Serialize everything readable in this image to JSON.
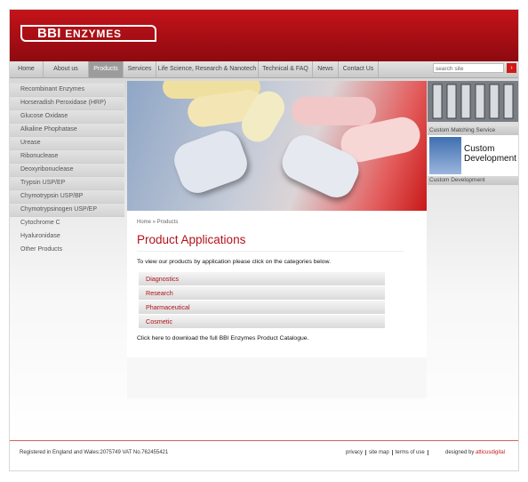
{
  "brand": {
    "logo_main": "BBI",
    "logo_sub": "ENZYMES"
  },
  "nav": {
    "items": [
      {
        "label": "Home"
      },
      {
        "label": "About us"
      },
      {
        "label": "Products"
      },
      {
        "label": "Services"
      },
      {
        "label": "Life Science, Research & Nanotech"
      },
      {
        "label": "Technical & FAQ"
      },
      {
        "label": "News"
      },
      {
        "label": "Contact Us"
      }
    ],
    "search_placeholder": "search site",
    "search_button": "›"
  },
  "sidebar": {
    "items": [
      {
        "label": "Recombinant Enzymes"
      },
      {
        "label": "Horseradish Peroxidase (HRP)"
      },
      {
        "label": "Glucose Oxidase"
      },
      {
        "label": "Alkaline Phophatase"
      },
      {
        "label": "Urease"
      },
      {
        "label": "Ribonuclease"
      },
      {
        "label": "Deoxyribonuclease"
      },
      {
        "label": "Trypsin USP/EP"
      },
      {
        "label": "Chymotrypsin USP/BP"
      },
      {
        "label": "Chymotrypsinogen USP/EP"
      },
      {
        "label": "Cytochrome C"
      },
      {
        "label": "Hyaluronidase"
      },
      {
        "label": "Other Products"
      }
    ]
  },
  "main": {
    "breadcrumb": "Home » Products",
    "title": "Product Applications",
    "intro": "To view our products by application please click on the categories below.",
    "applications": [
      {
        "label": "Diagnostics"
      },
      {
        "label": "Research"
      },
      {
        "label": "Pharmaceutical"
      },
      {
        "label": "Cosmetic"
      }
    ],
    "download_text": "Click here to download the full BBI Enzymes Product Catalogue."
  },
  "right": {
    "promos": [
      {
        "caption": "Custom Matching Service"
      },
      {
        "caption": "Custom Development",
        "image_text": "Custom Development"
      }
    ]
  },
  "footer": {
    "registered": "Registered in England and Wales:2075749 VAT No.762455421",
    "links": [
      {
        "label": "privacy"
      },
      {
        "label": "site map"
      },
      {
        "label": "terms of use"
      }
    ],
    "credit_prefix": "designed by",
    "credit_brand": "atticusdigital"
  },
  "colors": {
    "brand_red": "#b1121a",
    "header_red": "#c4131a"
  }
}
